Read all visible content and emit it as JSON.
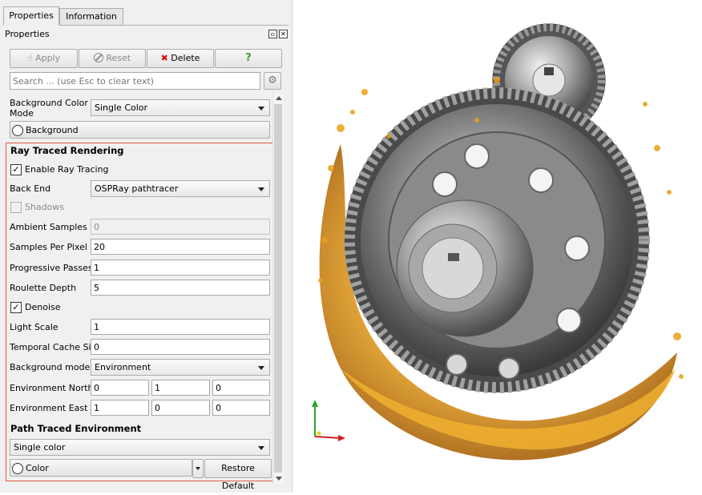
{
  "tabs": [
    {
      "label": "Properties"
    },
    {
      "label": "Information"
    }
  ],
  "panel_title": "Properties",
  "toolbar": {
    "apply": "Apply",
    "reset": "Reset",
    "delete": "Delete",
    "help": "?"
  },
  "search": {
    "placeholder": "Search ... (use Esc to clear text)"
  },
  "background": {
    "mode_label": "Background Color Mode",
    "mode_value": "Single Color",
    "button_label": "Background"
  },
  "ray_traced": {
    "title": "Ray Traced Rendering",
    "enable_label": "Enable Ray Tracing",
    "backend_label": "Back End",
    "backend_value": "OSPRay pathtracer",
    "shadows_label": "Shadows",
    "ambient_label": "Ambient Samples",
    "ambient_value": "0",
    "spp_label": "Samples Per Pixel",
    "spp_value": "20",
    "passes_label": "Progressive Passes",
    "passes_value": "1",
    "roulette_label": "Roulette Depth",
    "roulette_value": "5",
    "denoise_label": "Denoise",
    "light_label": "Light Scale",
    "light_value": "1",
    "cache_label": "Temporal Cache Size",
    "cache_value": "0",
    "bgmode_label": "Background mode",
    "bgmode_value": "Environment",
    "north_label": "Environment North",
    "north_values": [
      "0",
      "1",
      "0"
    ],
    "east_label": "Environment East",
    "east_values": [
      "1",
      "0",
      "0"
    ]
  },
  "path_traced": {
    "title": "Path Traced Environment",
    "mode_value": "Single color",
    "color_label": "Color",
    "restore_label": "Restore Default"
  },
  "colors": {
    "highlight": "#e05a3c",
    "delete_icon": "#cc1111",
    "help_icon": "#3aa32a",
    "fluid": "#e8a019"
  }
}
